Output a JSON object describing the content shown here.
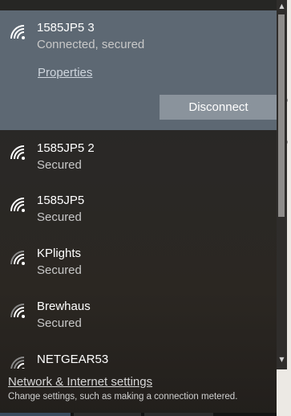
{
  "connected": {
    "ssid": "1585JP5 3",
    "status": "Connected, secured",
    "properties_label": "Properties",
    "disconnect_label": "Disconnect",
    "signal_icon": "wifi-signal-icon"
  },
  "networks": [
    {
      "ssid": "1585JP5 2",
      "status": "Secured",
      "signal_icon": "wifi-signal-icon"
    },
    {
      "ssid": "1585JP5",
      "status": "Secured",
      "signal_icon": "wifi-signal-icon"
    },
    {
      "ssid": "KPlights",
      "status": "Secured",
      "signal_icon": "wifi-signal-icon"
    },
    {
      "ssid": "Brewhaus",
      "status": "Secured",
      "signal_icon": "wifi-signal-icon"
    },
    {
      "ssid": "NETGEAR53",
      "status": "",
      "signal_icon": "wifi-signal-icon"
    }
  ],
  "footer": {
    "link": "Network & Internet settings",
    "description": "Change settings, such as making a connection metered."
  },
  "scrollbar": {
    "up_arrow": "▲",
    "down_arrow": "▼"
  },
  "colors": {
    "connected_bg": "#5d6873",
    "button_bg": "#8a939c",
    "flyout_bg": "#272523"
  }
}
